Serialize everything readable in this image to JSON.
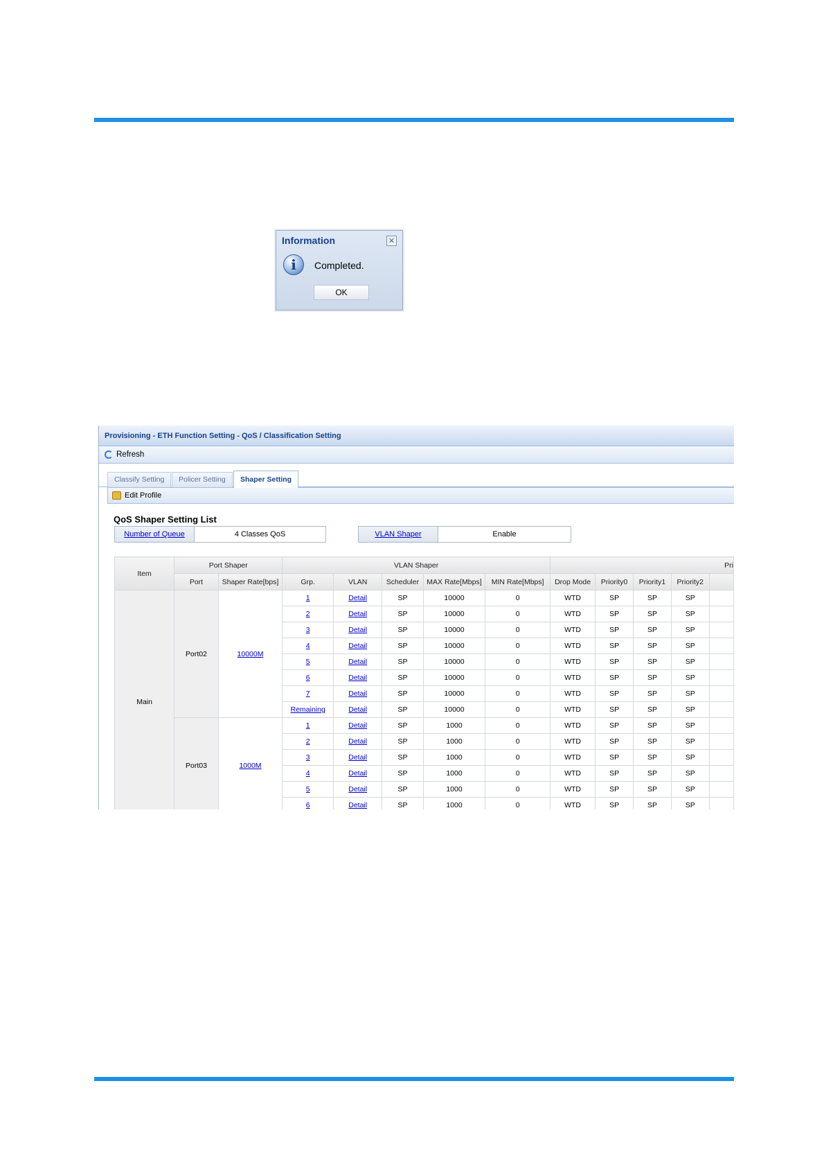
{
  "dialog": {
    "title": "Information",
    "close_icon": "close-icon",
    "message": "Completed.",
    "ok_label": "OK"
  },
  "app": {
    "breadcrumb": "Provisioning - ETH Function Setting - QoS / Classification Setting",
    "refresh_label": "Refresh",
    "tabs": [
      {
        "label": "Classify Setting",
        "active": false
      },
      {
        "label": "Policer Setting",
        "active": false
      },
      {
        "label": "Shaper Setting",
        "active": true
      }
    ],
    "edit_profile_label": "Edit Profile",
    "list_title": "QoS Shaper Setting List",
    "summary": {
      "queue_label": "Number of Queue",
      "queue_value": "4 Classes QoS",
      "vlan_label": "VLAN Shaper",
      "vlan_value": "Enable"
    },
    "table": {
      "group_headers": {
        "item": "Item",
        "port_shaper": "Port Shaper",
        "vlan_shaper": "VLAN Shaper",
        "priority": "Pri"
      },
      "columns": [
        "Port",
        "Shaper Rate[bps]",
        "Grp.",
        "VLAN",
        "Scheduler",
        "MAX Rate[Mbps]",
        "MIN Rate[Mbps]",
        "Drop Mode",
        "Priority0",
        "Priority1",
        "Priority2"
      ],
      "item": "Main",
      "ports": [
        {
          "port": "Port02",
          "rate": "10000M",
          "rows": [
            {
              "grp": "1",
              "vlan": "Detail",
              "scheduler": "SP",
              "max": "10000",
              "min": "0",
              "drop": "WTD",
              "p0": "SP",
              "p1": "SP",
              "p2": "SP"
            },
            {
              "grp": "2",
              "vlan": "Detail",
              "scheduler": "SP",
              "max": "10000",
              "min": "0",
              "drop": "WTD",
              "p0": "SP",
              "p1": "SP",
              "p2": "SP"
            },
            {
              "grp": "3",
              "vlan": "Detail",
              "scheduler": "SP",
              "max": "10000",
              "min": "0",
              "drop": "WTD",
              "p0": "SP",
              "p1": "SP",
              "p2": "SP"
            },
            {
              "grp": "4",
              "vlan": "Detail",
              "scheduler": "SP",
              "max": "10000",
              "min": "0",
              "drop": "WTD",
              "p0": "SP",
              "p1": "SP",
              "p2": "SP"
            },
            {
              "grp": "5",
              "vlan": "Detail",
              "scheduler": "SP",
              "max": "10000",
              "min": "0",
              "drop": "WTD",
              "p0": "SP",
              "p1": "SP",
              "p2": "SP"
            },
            {
              "grp": "6",
              "vlan": "Detail",
              "scheduler": "SP",
              "max": "10000",
              "min": "0",
              "drop": "WTD",
              "p0": "SP",
              "p1": "SP",
              "p2": "SP"
            },
            {
              "grp": "7",
              "vlan": "Detail",
              "scheduler": "SP",
              "max": "10000",
              "min": "0",
              "drop": "WTD",
              "p0": "SP",
              "p1": "SP",
              "p2": "SP"
            },
            {
              "grp": "Remaining",
              "vlan": "Detail",
              "scheduler": "SP",
              "max": "10000",
              "min": "0",
              "drop": "WTD",
              "p0": "SP",
              "p1": "SP",
              "p2": "SP"
            }
          ]
        },
        {
          "port": "Port03",
          "rate": "1000M",
          "rows": [
            {
              "grp": "1",
              "vlan": "Detail",
              "scheduler": "SP",
              "max": "1000",
              "min": "0",
              "drop": "WTD",
              "p0": "SP",
              "p1": "SP",
              "p2": "SP"
            },
            {
              "grp": "2",
              "vlan": "Detail",
              "scheduler": "SP",
              "max": "1000",
              "min": "0",
              "drop": "WTD",
              "p0": "SP",
              "p1": "SP",
              "p2": "SP"
            },
            {
              "grp": "3",
              "vlan": "Detail",
              "scheduler": "SP",
              "max": "1000",
              "min": "0",
              "drop": "WTD",
              "p0": "SP",
              "p1": "SP",
              "p2": "SP"
            },
            {
              "grp": "4",
              "vlan": "Detail",
              "scheduler": "SP",
              "max": "1000",
              "min": "0",
              "drop": "WTD",
              "p0": "SP",
              "p1": "SP",
              "p2": "SP"
            },
            {
              "grp": "5",
              "vlan": "Detail",
              "scheduler": "SP",
              "max": "1000",
              "min": "0",
              "drop": "WTD",
              "p0": "SP",
              "p1": "SP",
              "p2": "SP"
            },
            {
              "grp": "6",
              "vlan": "Detail",
              "scheduler": "SP",
              "max": "1000",
              "min": "0",
              "drop": "WTD",
              "p0": "SP",
              "p1": "SP",
              "p2": "SP"
            }
          ]
        }
      ]
    }
  }
}
